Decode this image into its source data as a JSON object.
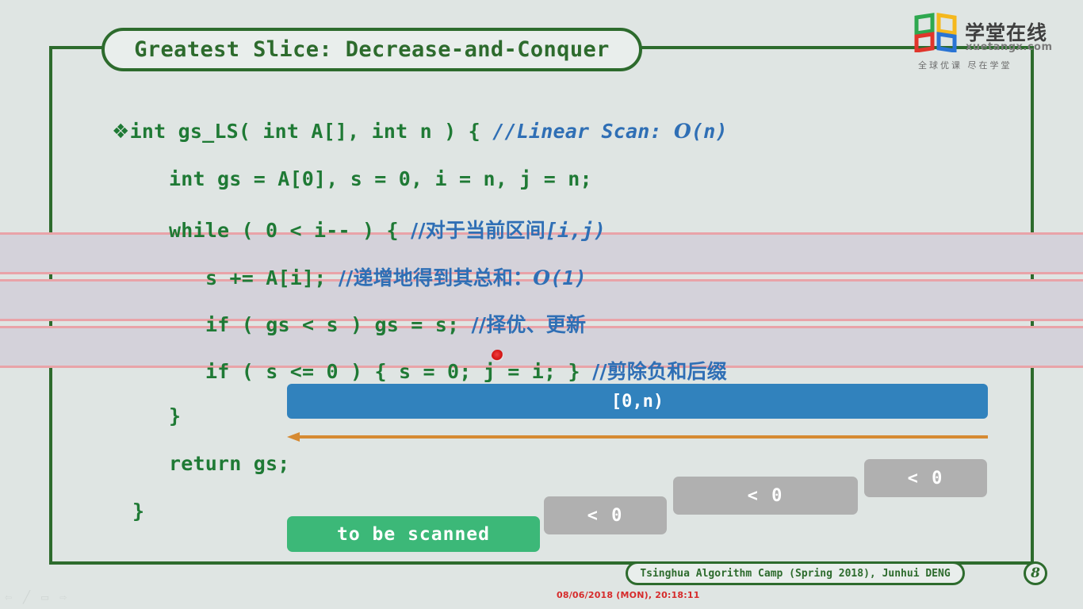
{
  "slide": {
    "title": "Greatest Slice: Decrease-and-Conquer",
    "page_number": "8",
    "footer": "Tsinghua Algorithm Camp (Spring 2018), Junhui DENG",
    "timestamp": "08/06/2018 (MON), 20:18:11",
    "background_color": "#dfe5e3",
    "frame_color": "#2d6b2d"
  },
  "code": {
    "line1": {
      "bullet": "❖",
      "text": "int gs_LS( int A[], int n ) { ",
      "comment": "//Linear Scan: ",
      "complexity_O": "O",
      "complexity_arg": "(n)"
    },
    "line2": {
      "text": "int gs = A[0], s = 0, i = n, j = n;"
    },
    "line3": {
      "text": "while ( 0 < i-- ) { ",
      "comment": "//对于当前区间",
      "comment_tail": "[i,j)"
    },
    "line4": {
      "text": "s += A[i]; ",
      "comment": "//递增地得到其总和：",
      "complexity_O": "O",
      "complexity_arg": "(1)"
    },
    "line5": {
      "text": "if ( gs < s ) gs = s; ",
      "comment": "//择优、更新"
    },
    "line6": {
      "text": "if ( s <= 0 ) { s = 0; j = i; } ",
      "comment": "//剪除负和后缀"
    },
    "line7": {
      "text": "}"
    },
    "line8": {
      "text": "return gs;"
    },
    "line9": {
      "text": "}"
    },
    "code_color": "#1f7a35",
    "comment_color": "#2f6fb5"
  },
  "diagram": {
    "blue_bar_label": "[0,n)",
    "blue_bar_color": "#3182bd",
    "arrow_color": "#d68a32",
    "green_box_label": "to be scanned",
    "green_box_color": "#3cb878",
    "gray_box_color": "#b0b0b0",
    "gray_boxes": [
      {
        "label": "< 0"
      },
      {
        "label": "< 0"
      },
      {
        "label": "< 0"
      }
    ]
  },
  "logo": {
    "brand": "学堂在线",
    "url": "xuetangx.com",
    "tagline": "全球优课 尽在学堂",
    "colors": [
      "#2ea84f",
      "#f5b81d",
      "#e0352b",
      "#2a74d4"
    ]
  },
  "presentation_controls": [
    {
      "name": "previous-slide-icon",
      "glyph": "⇦"
    },
    {
      "name": "pen-icon",
      "glyph": "╱"
    },
    {
      "name": "slide-menu-icon",
      "glyph": "▭"
    },
    {
      "name": "next-slide-icon",
      "glyph": "⇨"
    }
  ],
  "cursor": {
    "name": "laser-pointer-dot",
    "color": "#d01010"
  }
}
